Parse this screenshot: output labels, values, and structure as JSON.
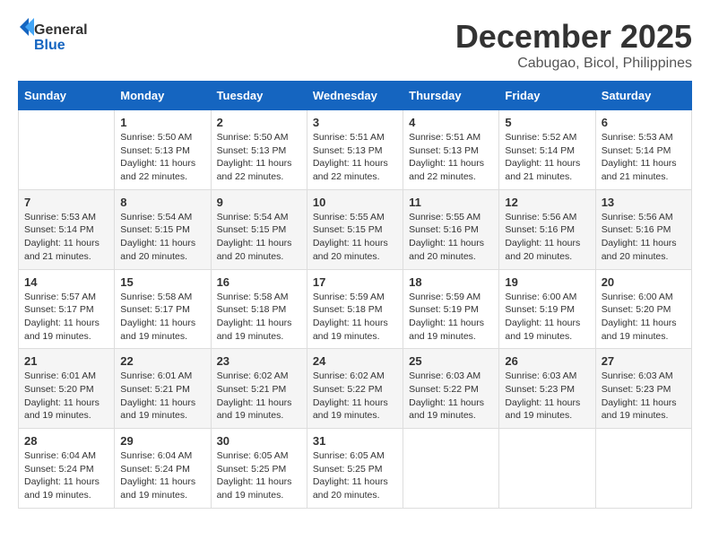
{
  "logo": {
    "general": "General",
    "blue": "Blue"
  },
  "title": "December 2025",
  "location": "Cabugao, Bicol, Philippines",
  "days_of_week": [
    "Sunday",
    "Monday",
    "Tuesday",
    "Wednesday",
    "Thursday",
    "Friday",
    "Saturday"
  ],
  "weeks": [
    [
      {
        "day": "",
        "info": ""
      },
      {
        "day": "1",
        "info": "Sunrise: 5:50 AM\nSunset: 5:13 PM\nDaylight: 11 hours\nand 22 minutes."
      },
      {
        "day": "2",
        "info": "Sunrise: 5:50 AM\nSunset: 5:13 PM\nDaylight: 11 hours\nand 22 minutes."
      },
      {
        "day": "3",
        "info": "Sunrise: 5:51 AM\nSunset: 5:13 PM\nDaylight: 11 hours\nand 22 minutes."
      },
      {
        "day": "4",
        "info": "Sunrise: 5:51 AM\nSunset: 5:13 PM\nDaylight: 11 hours\nand 22 minutes."
      },
      {
        "day": "5",
        "info": "Sunrise: 5:52 AM\nSunset: 5:14 PM\nDaylight: 11 hours\nand 21 minutes."
      },
      {
        "day": "6",
        "info": "Sunrise: 5:53 AM\nSunset: 5:14 PM\nDaylight: 11 hours\nand 21 minutes."
      }
    ],
    [
      {
        "day": "7",
        "info": "Sunrise: 5:53 AM\nSunset: 5:14 PM\nDaylight: 11 hours\nand 21 minutes."
      },
      {
        "day": "8",
        "info": "Sunrise: 5:54 AM\nSunset: 5:15 PM\nDaylight: 11 hours\nand 20 minutes."
      },
      {
        "day": "9",
        "info": "Sunrise: 5:54 AM\nSunset: 5:15 PM\nDaylight: 11 hours\nand 20 minutes."
      },
      {
        "day": "10",
        "info": "Sunrise: 5:55 AM\nSunset: 5:15 PM\nDaylight: 11 hours\nand 20 minutes."
      },
      {
        "day": "11",
        "info": "Sunrise: 5:55 AM\nSunset: 5:16 PM\nDaylight: 11 hours\nand 20 minutes."
      },
      {
        "day": "12",
        "info": "Sunrise: 5:56 AM\nSunset: 5:16 PM\nDaylight: 11 hours\nand 20 minutes."
      },
      {
        "day": "13",
        "info": "Sunrise: 5:56 AM\nSunset: 5:16 PM\nDaylight: 11 hours\nand 20 minutes."
      }
    ],
    [
      {
        "day": "14",
        "info": "Sunrise: 5:57 AM\nSunset: 5:17 PM\nDaylight: 11 hours\nand 19 minutes."
      },
      {
        "day": "15",
        "info": "Sunrise: 5:58 AM\nSunset: 5:17 PM\nDaylight: 11 hours\nand 19 minutes."
      },
      {
        "day": "16",
        "info": "Sunrise: 5:58 AM\nSunset: 5:18 PM\nDaylight: 11 hours\nand 19 minutes."
      },
      {
        "day": "17",
        "info": "Sunrise: 5:59 AM\nSunset: 5:18 PM\nDaylight: 11 hours\nand 19 minutes."
      },
      {
        "day": "18",
        "info": "Sunrise: 5:59 AM\nSunset: 5:19 PM\nDaylight: 11 hours\nand 19 minutes."
      },
      {
        "day": "19",
        "info": "Sunrise: 6:00 AM\nSunset: 5:19 PM\nDaylight: 11 hours\nand 19 minutes."
      },
      {
        "day": "20",
        "info": "Sunrise: 6:00 AM\nSunset: 5:20 PM\nDaylight: 11 hours\nand 19 minutes."
      }
    ],
    [
      {
        "day": "21",
        "info": "Sunrise: 6:01 AM\nSunset: 5:20 PM\nDaylight: 11 hours\nand 19 minutes."
      },
      {
        "day": "22",
        "info": "Sunrise: 6:01 AM\nSunset: 5:21 PM\nDaylight: 11 hours\nand 19 minutes."
      },
      {
        "day": "23",
        "info": "Sunrise: 6:02 AM\nSunset: 5:21 PM\nDaylight: 11 hours\nand 19 minutes."
      },
      {
        "day": "24",
        "info": "Sunrise: 6:02 AM\nSunset: 5:22 PM\nDaylight: 11 hours\nand 19 minutes."
      },
      {
        "day": "25",
        "info": "Sunrise: 6:03 AM\nSunset: 5:22 PM\nDaylight: 11 hours\nand 19 minutes."
      },
      {
        "day": "26",
        "info": "Sunrise: 6:03 AM\nSunset: 5:23 PM\nDaylight: 11 hours\nand 19 minutes."
      },
      {
        "day": "27",
        "info": "Sunrise: 6:03 AM\nSunset: 5:23 PM\nDaylight: 11 hours\nand 19 minutes."
      }
    ],
    [
      {
        "day": "28",
        "info": "Sunrise: 6:04 AM\nSunset: 5:24 PM\nDaylight: 11 hours\nand 19 minutes."
      },
      {
        "day": "29",
        "info": "Sunrise: 6:04 AM\nSunset: 5:24 PM\nDaylight: 11 hours\nand 19 minutes."
      },
      {
        "day": "30",
        "info": "Sunrise: 6:05 AM\nSunset: 5:25 PM\nDaylight: 11 hours\nand 19 minutes."
      },
      {
        "day": "31",
        "info": "Sunrise: 6:05 AM\nSunset: 5:25 PM\nDaylight: 11 hours\nand 20 minutes."
      },
      {
        "day": "",
        "info": ""
      },
      {
        "day": "",
        "info": ""
      },
      {
        "day": "",
        "info": ""
      }
    ]
  ]
}
